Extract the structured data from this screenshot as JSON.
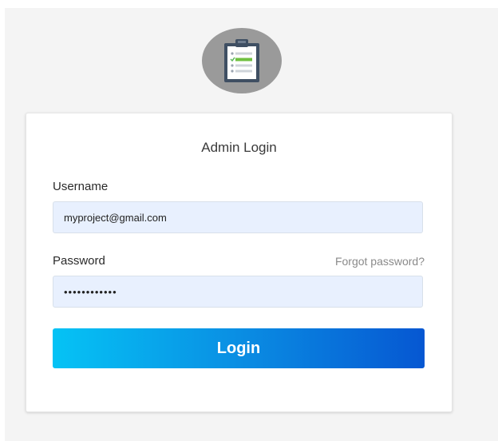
{
  "logo": {
    "icon": "clipboard-checklist-icon"
  },
  "login_form": {
    "title": "Admin Login",
    "username_label": "Username",
    "username_value": "myproject@gmail.com",
    "password_label": "Password",
    "password_value": "••••••••••••",
    "forgot_link": "Forgot password?",
    "submit_label": "Login"
  },
  "colors": {
    "background": "#f4f4f4",
    "input_fill": "#e8f0fe",
    "button_gradient_start": "#05c3f5",
    "button_gradient_end": "#0657d2"
  }
}
